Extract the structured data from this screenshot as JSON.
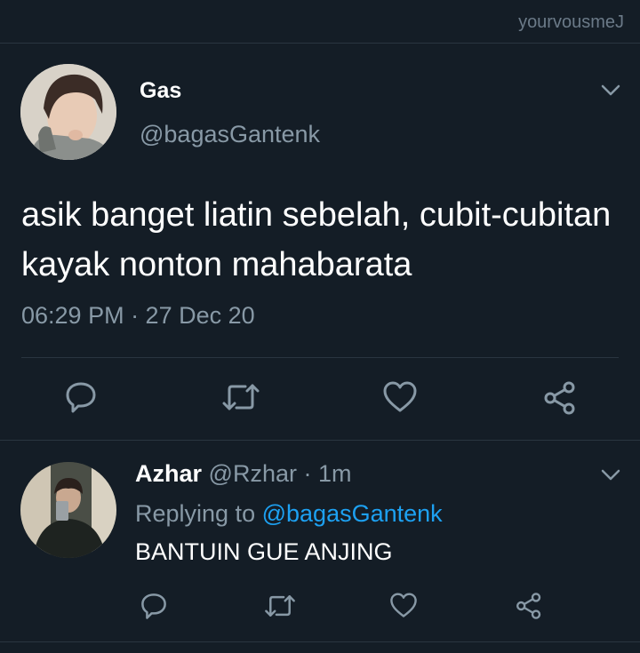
{
  "watermark": "yourvousmeJ",
  "tweet": {
    "name": "Gas",
    "handle": "@bagasGantenk",
    "text": "asik banget liatin sebelah, cubit-cubitan kayak nonton mahabarata",
    "timestamp": "06:29 PM · 27 Dec 20"
  },
  "reply": {
    "name": "Azhar",
    "handle": "@Rzhar",
    "separator": "·",
    "time": "1m",
    "replying_prefix": "Replying to",
    "replying_to": "@bagasGantenk",
    "text": "BANTUIN GUE ANJING"
  },
  "icons": {
    "reply": "speech-bubble-icon",
    "retweet": "retweet-icon",
    "like": "heart-icon",
    "share": "share-icon",
    "menu": "chevron-down-icon"
  },
  "colors": {
    "background": "#141d26",
    "muted": "#8899a6",
    "link": "#1da1f2"
  }
}
